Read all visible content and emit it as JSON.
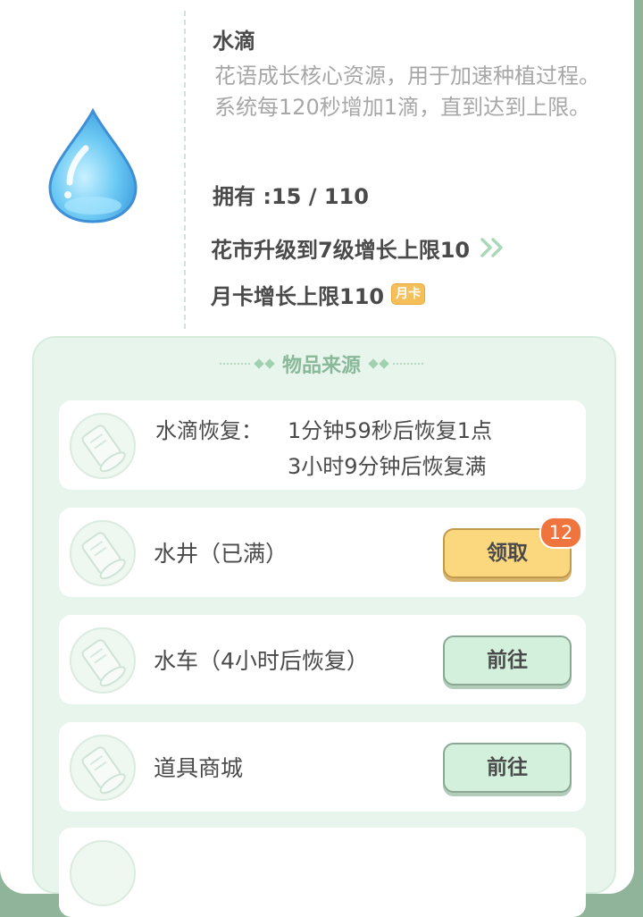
{
  "item": {
    "icon": "water-drop-icon",
    "name": "水滴",
    "description": "花语成长核心资源，用于加速种植过程。系统每120秒增加1滴，直到达到上限。",
    "owned_text": "拥有 :15 / 110",
    "upgrade_text": "花市升级到7级增长上限10",
    "monthly_text": "月卡增长上限110",
    "monthly_badge": "月卡"
  },
  "sources": {
    "title": "物品来源",
    "recovery": {
      "label": "水滴恢复：",
      "line1": "1分钟59秒后恢复1点",
      "line2": "3小时9分钟后恢复满"
    },
    "rows": [
      {
        "label": "水井（已满）",
        "button": "领取",
        "badge": "12"
      },
      {
        "label": "水车（4小时后恢复）",
        "button": "前往"
      },
      {
        "label": "道具商城",
        "button": "前往"
      }
    ]
  },
  "colors": {
    "accent_green": "#d3f0dd",
    "accent_gold": "#fbd77d",
    "badge_orange": "#f0743e",
    "panel_bg": "#e8f5ec"
  }
}
